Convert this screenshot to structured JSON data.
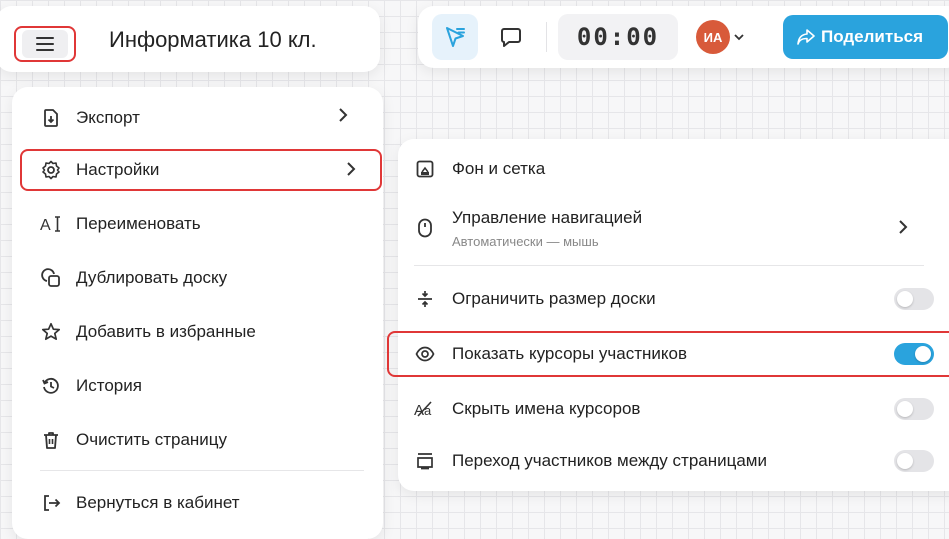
{
  "header": {
    "board_title": "Информатика 10 кл."
  },
  "toolbar": {
    "timer": "00:00",
    "avatar_initials": "ИА",
    "share_label": "Поделиться"
  },
  "menu": {
    "items": [
      {
        "label": "Экспорт",
        "icon": "export-icon"
      },
      {
        "label": "Настройки",
        "icon": "gear-icon"
      },
      {
        "label": "Переименовать",
        "icon": "rename-icon"
      },
      {
        "label": "Дублировать доску",
        "icon": "duplicate-icon"
      },
      {
        "label": "Добавить в избранные",
        "icon": "star-icon"
      },
      {
        "label": "История",
        "icon": "history-icon"
      },
      {
        "label": "Очистить страницу",
        "icon": "trash-icon"
      },
      {
        "label": "Вернуться в кабинет",
        "icon": "exit-icon"
      }
    ]
  },
  "settings": {
    "background_label": "Фон и сетка",
    "navigation_label": "Управление навигацией",
    "navigation_value": "Автоматически — мышь",
    "toggles": [
      {
        "label": "Ограничить размер доски",
        "on": false
      },
      {
        "label": "Показать курсоры участников",
        "on": true
      },
      {
        "label": "Скрыть имена курсоров",
        "on": false
      },
      {
        "label": "Переход участников между страницами",
        "on": false
      }
    ]
  },
  "colors": {
    "accent": "#2aa3dd",
    "highlight": "#e03737",
    "avatar": "#d85a3a"
  }
}
